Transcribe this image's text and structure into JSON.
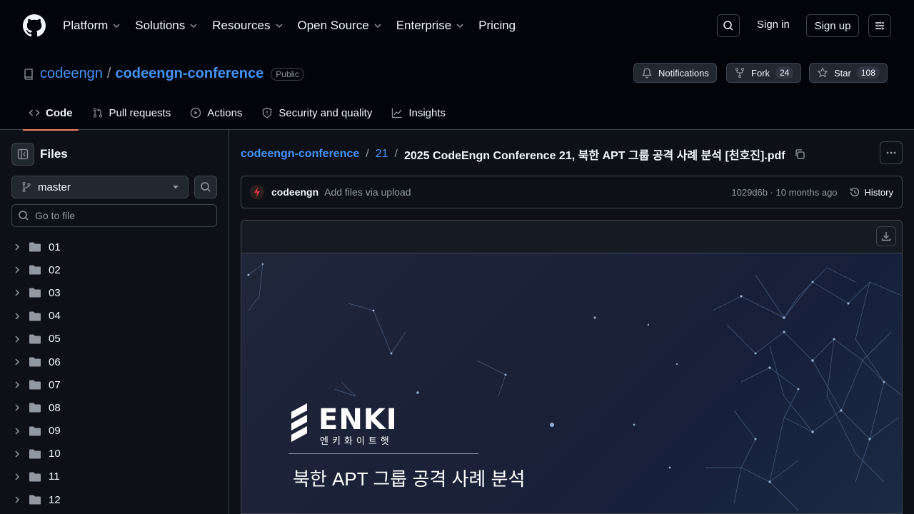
{
  "header": {
    "nav": [
      {
        "label": "Platform",
        "has_menu": true
      },
      {
        "label": "Solutions",
        "has_menu": true
      },
      {
        "label": "Resources",
        "has_menu": true
      },
      {
        "label": "Open Source",
        "has_menu": true
      },
      {
        "label": "Enterprise",
        "has_menu": true
      },
      {
        "label": "Pricing",
        "has_menu": false
      }
    ],
    "sign_in": "Sign in",
    "sign_up": "Sign up"
  },
  "repo": {
    "owner": "codeengn",
    "separator": "/",
    "name": "codeengn-conference",
    "visibility": "Public",
    "notifications_label": "Notifications",
    "fork_label": "Fork",
    "fork_count": "24",
    "star_label": "Star",
    "star_count": "108",
    "tabs": [
      "Code",
      "Pull requests",
      "Actions",
      "Security and quality",
      "Insights"
    ]
  },
  "sidebar": {
    "title": "Files",
    "branch": "master",
    "goto_placeholder": "Go to file",
    "folders": [
      "01",
      "02",
      "03",
      "04",
      "05",
      "06",
      "07",
      "08",
      "09",
      "10",
      "11",
      "12"
    ]
  },
  "file": {
    "crumb_repo": "codeengn-conference",
    "crumb_dir": "21",
    "crumb_sep": "/",
    "filename": "2025 CodeEngn Conference 21, 북한 APT 그룹 공격 사례 분석 [천호진].pdf",
    "commit_author": "codeengn",
    "commit_message": "Add files via upload",
    "commit_meta": "1029d6b · 10 months ago",
    "history_label": "History"
  },
  "pdf": {
    "logo_text": "ENKI",
    "logo_korean": "엔키화이트햇",
    "title": "북한 APT 그룹 공격 사례 분석"
  },
  "colors": {
    "bg": "#0d1117",
    "header_bg": "#010409",
    "accent_link": "#4493f8",
    "active_tab_underline": "#f78166",
    "border": "#3d444d"
  }
}
